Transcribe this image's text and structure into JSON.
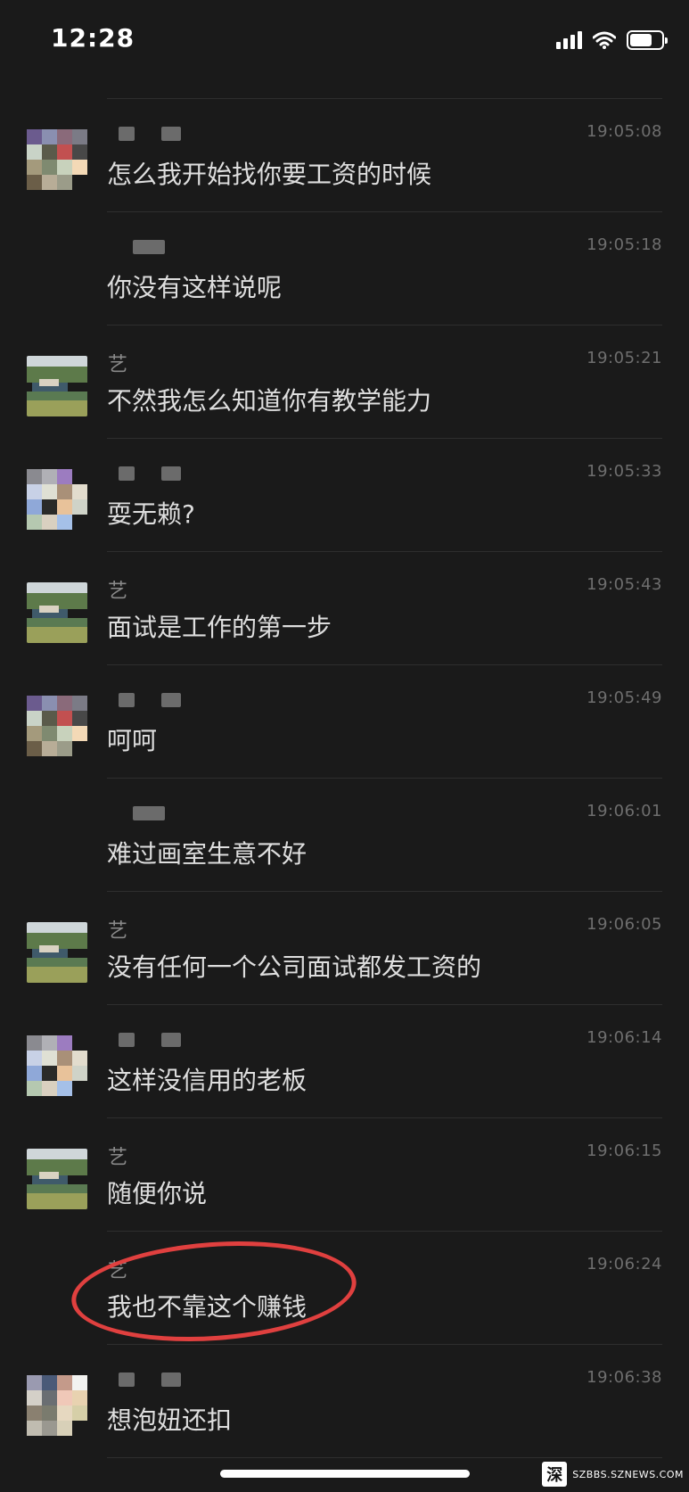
{
  "status_bar": {
    "time": "12:28"
  },
  "messages": [
    {
      "sender": "",
      "avatar": "pixel-1",
      "time": "19:05:08",
      "text": "怎么我开始找你要工资的时候"
    },
    {
      "sender": "",
      "avatar": "none",
      "time": "19:05:18",
      "text": "你没有这样说呢"
    },
    {
      "sender": "艺",
      "avatar": "scenic",
      "time": "19:05:21",
      "text": "不然我怎么知道你有教学能力"
    },
    {
      "sender": "",
      "avatar": "pixel-2",
      "time": "19:05:33",
      "text": "耍无赖?"
    },
    {
      "sender": "艺",
      "avatar": "scenic",
      "time": "19:05:43",
      "text": "面试是工作的第一步"
    },
    {
      "sender": "",
      "avatar": "pixel-1",
      "time": "19:05:49",
      "text": "呵呵"
    },
    {
      "sender": "",
      "avatar": "none",
      "time": "19:06:01",
      "text": "难过画室生意不好"
    },
    {
      "sender": "艺",
      "avatar": "scenic",
      "time": "19:06:05",
      "text": "没有任何一个公司面试都发工资的"
    },
    {
      "sender": "",
      "avatar": "pixel-2",
      "time": "19:06:14",
      "text": "这样没信用的老板"
    },
    {
      "sender": "艺",
      "avatar": "scenic",
      "time": "19:06:15",
      "text": "随便你说"
    },
    {
      "sender": "艺",
      "avatar": "none",
      "time": "19:06:24",
      "text": "我也不靠这个赚钱"
    },
    {
      "sender": "",
      "avatar": "pixel-3",
      "time": "19:06:38",
      "text": "想泡妞还扣"
    }
  ],
  "watermark": {
    "mark": "深",
    "text": "SZBBS.SZNEWS.COM"
  },
  "colors": {
    "background": "#1a1a1a",
    "text": "#dedede",
    "timestamp": "#6e6e6e",
    "highlight": "#e0403f"
  }
}
